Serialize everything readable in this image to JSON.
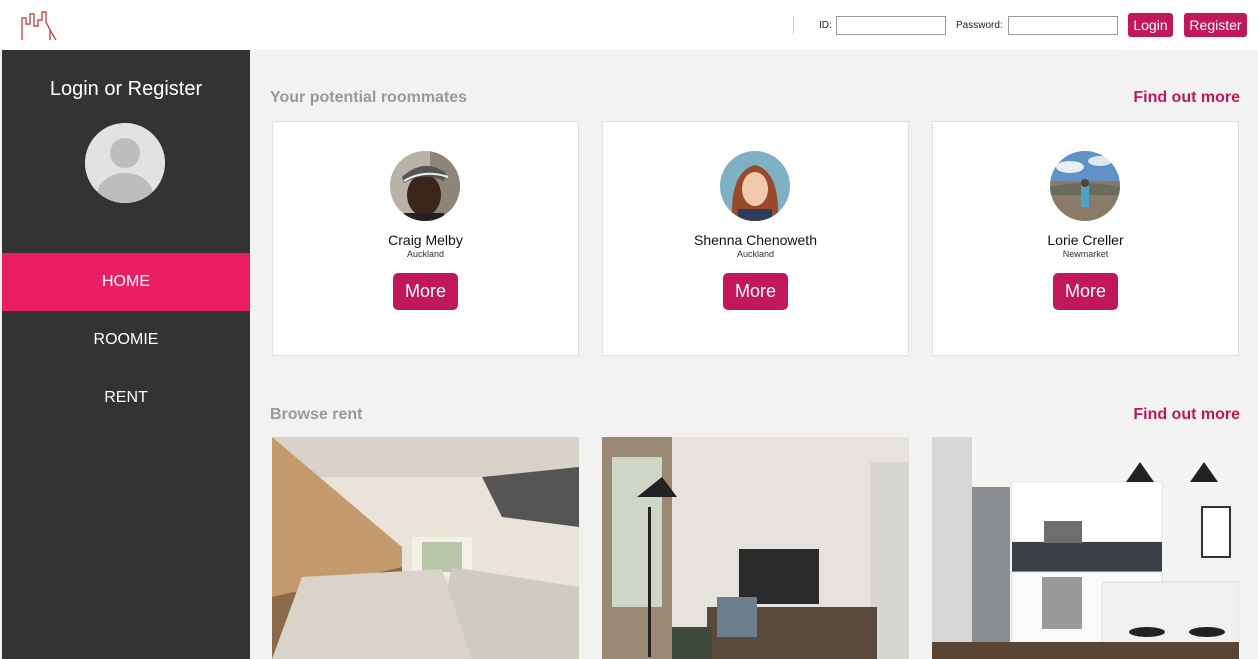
{
  "header": {
    "logo_icon": "city-skyline-icon",
    "id_label": "ID:",
    "id_value": "",
    "password_label": "Password:",
    "password_value": "",
    "login_label": "Login",
    "register_label": "Register"
  },
  "sidebar": {
    "title": "Login or Register",
    "avatar_icon": "default-user-icon",
    "items": [
      {
        "label": "HOME",
        "active": true
      },
      {
        "label": "ROOMIE",
        "active": false
      },
      {
        "label": "RENT",
        "active": false
      }
    ]
  },
  "roommates": {
    "title": "Your potential roommates",
    "link": "Find out more",
    "people": [
      {
        "name": "Craig Melby",
        "location": "Auckland",
        "button": "More"
      },
      {
        "name": "Shenna Chenoweth",
        "location": "Auckland",
        "button": "More"
      },
      {
        "name": "Lorie Creller",
        "location": "Newmarket",
        "button": "More"
      }
    ]
  },
  "rent": {
    "title": "Browse rent",
    "link": "Find out more"
  },
  "colors": {
    "accent": "#c2185b",
    "nav_active": "#e91e63",
    "sidebar_bg": "#333333"
  }
}
